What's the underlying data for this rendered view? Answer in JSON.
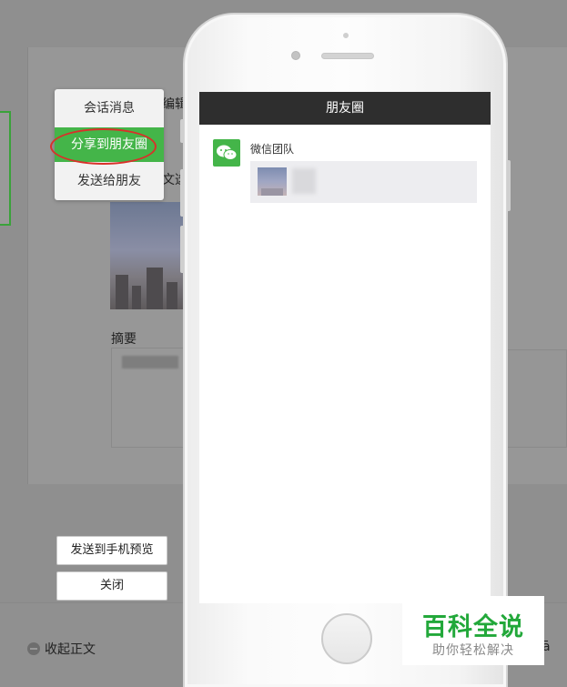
{
  "editor": {
    "edit_label": "编辑",
    "select_label": "文选",
    "summary_label": "摘要",
    "collapse_label": "收起正文",
    "partial_right": "ā"
  },
  "share_menu": {
    "items": [
      {
        "label": "会话消息"
      },
      {
        "label": "分享到朋友圈"
      },
      {
        "label": "发送给朋友"
      }
    ],
    "highlight_color": "#44b549",
    "marker_color": "#d9302a"
  },
  "buttons": {
    "preview": "发送到手机预览",
    "close": "关闭"
  },
  "phone": {
    "nav_title": "朋友圈",
    "poster_name": "微信团队"
  },
  "watermark": {
    "main": "百科全说",
    "sub": "助你轻松解决",
    "color": "#22a83a"
  }
}
